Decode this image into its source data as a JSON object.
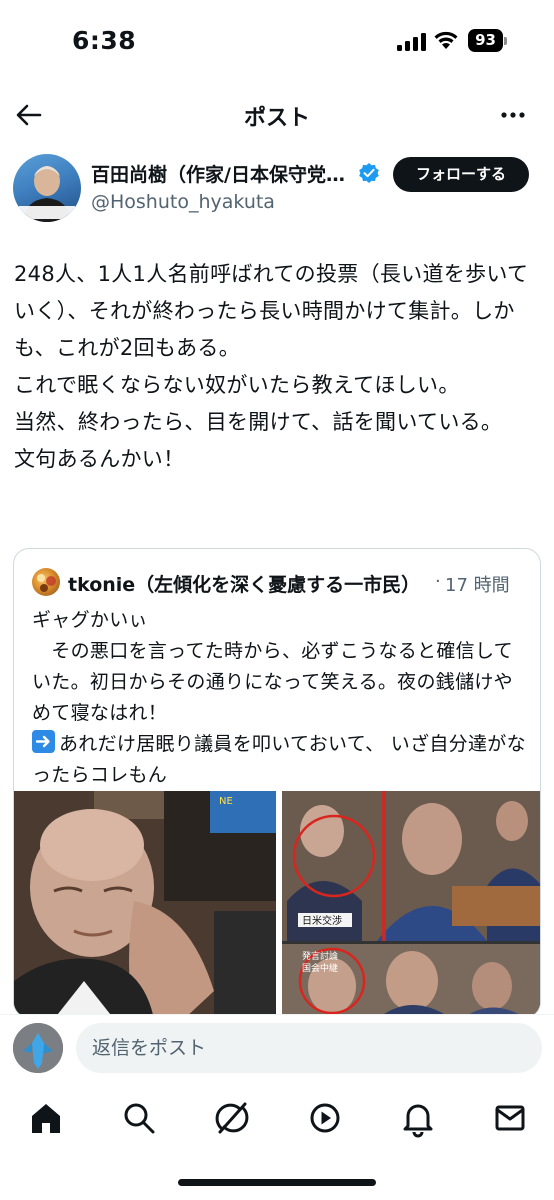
{
  "status_bar": {
    "time": "6:38",
    "battery": "93"
  },
  "header": {
    "title": "ポスト"
  },
  "author": {
    "name": "百田尚樹（作家/日本保守党代表）",
    "handle": "@Hoshuto_hyakuta",
    "follow_label": "フォローする",
    "avatar_caption": "百田尚樹"
  },
  "post": {
    "text": "248人、1人1人名前呼ばれての投票（長い道を歩いていく）、それが終わったら長い時間かけて集計。しかも、これが2回もある。\nこれで眠くならない奴がいたら教えてほしい。\n当然、終わったら、目を開けて、話を聞いている。\n文句あるんかい！"
  },
  "quote": {
    "name": "tkonie（左傾化を深く憂慮する一市民）",
    "dot": "·",
    "time": "17 時間",
    "text_line1": "ギャグかいぃ",
    "text_line2": "　その悪口を言ってた時から、必ずこうなると確信していた。初日からその通りになって笑える。夜の銭儲けやめて寝なはれ！",
    "text_line3": "あれだけ居眠り議員を叩いておいて、 いざ自分達がなったらコレもん",
    "media_caption_1": "日米交渉",
    "media_caption_2": "発言討論",
    "media_caption_3": "国会中継",
    "media_caption_4": "NE"
  },
  "reply": {
    "placeholder": "返信をポスト"
  },
  "tabs": [
    {
      "icon": "home-icon"
    },
    {
      "icon": "search-icon"
    },
    {
      "icon": "grok-icon"
    },
    {
      "icon": "video-icon"
    },
    {
      "icon": "notifications-icon"
    },
    {
      "icon": "messages-icon"
    }
  ],
  "colors": {
    "text": "#0f1419",
    "secondary": "#536471",
    "verified": "#1d9bf0",
    "border": "#cfd9de"
  }
}
